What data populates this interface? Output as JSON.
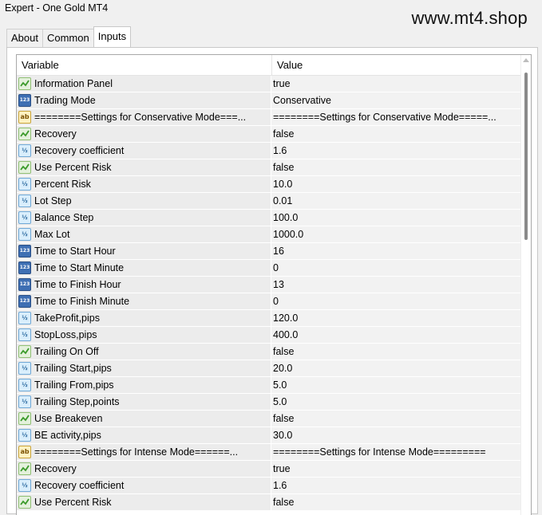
{
  "window": {
    "title": "Expert - One Gold MT4"
  },
  "watermark": "www.mt4.shop",
  "tabs": [
    {
      "label": "About"
    },
    {
      "label": "Common"
    },
    {
      "label": "Inputs",
      "active": true
    }
  ],
  "table": {
    "headers": {
      "variable": "Variable",
      "value": "Value"
    },
    "rows": [
      {
        "type": "bool",
        "name": "Information Panel",
        "value": "true"
      },
      {
        "type": "num",
        "name": "Trading Mode",
        "value": "Conservative"
      },
      {
        "type": "str",
        "name": "========Settings for Conservative Mode===...",
        "value": "========Settings for Conservative Mode=====..."
      },
      {
        "type": "bool",
        "name": "Recovery",
        "value": "false"
      },
      {
        "type": "real",
        "name": "Recovery coefficient",
        "value": "1.6"
      },
      {
        "type": "bool",
        "name": "Use Percent Risk",
        "value": "false"
      },
      {
        "type": "real",
        "name": "Percent Risk",
        "value": "10.0"
      },
      {
        "type": "real",
        "name": "Lot Step",
        "value": "0.01"
      },
      {
        "type": "real",
        "name": "Balance Step",
        "value": "100.0"
      },
      {
        "type": "real",
        "name": "Max Lot",
        "value": "1000.0"
      },
      {
        "type": "num",
        "name": "Time to Start Hour",
        "value": "16"
      },
      {
        "type": "num",
        "name": "Time to Start Minute",
        "value": "0"
      },
      {
        "type": "num",
        "name": "Time to Finish Hour",
        "value": "13"
      },
      {
        "type": "num",
        "name": "Time to Finish Minute",
        "value": "0"
      },
      {
        "type": "real",
        "name": "TakeProfit,pips",
        "value": "120.0"
      },
      {
        "type": "real",
        "name": "StopLoss,pips",
        "value": "400.0"
      },
      {
        "type": "bool",
        "name": "Trailing On Off",
        "value": "false"
      },
      {
        "type": "real",
        "name": "Trailing Start,pips",
        "value": "20.0"
      },
      {
        "type": "real",
        "name": "Trailing From,pips",
        "value": "5.0"
      },
      {
        "type": "real",
        "name": "Trailing Step,points",
        "value": "5.0"
      },
      {
        "type": "bool",
        "name": "Use Breakeven",
        "value": "false"
      },
      {
        "type": "real",
        "name": "BE activity,pips",
        "value": "30.0"
      },
      {
        "type": "str",
        "name": "========Settings for Intense Mode======...",
        "value": "========Settings for Intense Mode========="
      },
      {
        "type": "bool",
        "name": "Recovery",
        "value": "true"
      },
      {
        "type": "real",
        "name": "Recovery coefficient",
        "value": "1.6"
      },
      {
        "type": "bool",
        "name": "Use Percent Risk",
        "value": "false"
      }
    ]
  },
  "icons": {
    "bool": "bool-type-icon",
    "num": "integer-type-icon",
    "real": "double-type-icon",
    "str": "string-type-icon"
  },
  "icon_glyphs": {
    "num": "123",
    "real": "½",
    "str": "ab"
  }
}
